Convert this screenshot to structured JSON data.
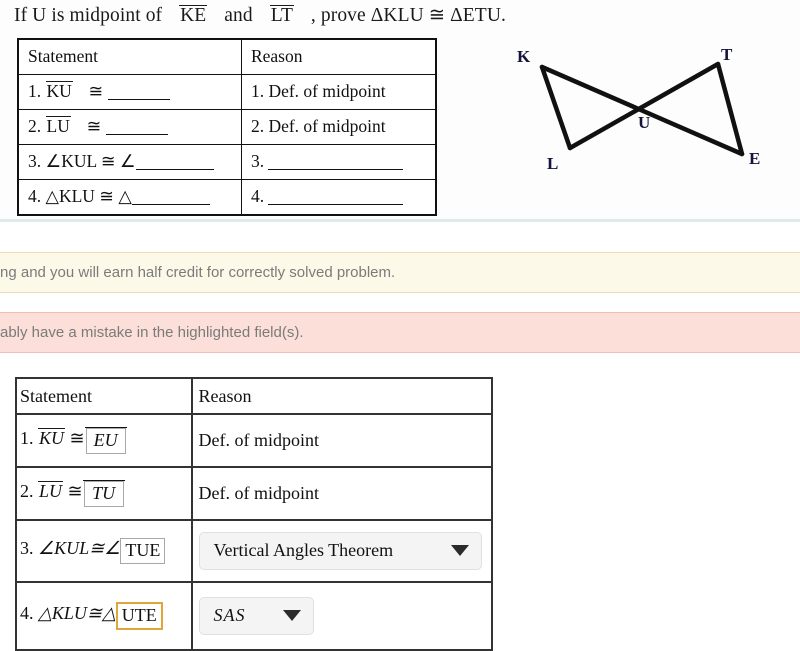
{
  "problem": {
    "prefix": "If U is midpoint of",
    "seg1": "KE",
    "conjunction": "and",
    "seg2": "LT",
    "suffix": ", prove ΔKLU ≅ ΔETU."
  },
  "proof_table_image": {
    "headers": [
      "Statement",
      "Reason"
    ],
    "rows": [
      {
        "statement_num": "1.",
        "statement_seg": "KU",
        "statement_rel": "≅",
        "reason": "1. Def. of midpoint"
      },
      {
        "statement_num": "2.",
        "statement_seg": "LU",
        "statement_rel": "≅",
        "reason": "2. Def. of midpoint"
      },
      {
        "statement_num": "3.",
        "statement_text": "∠KUL ≅ ∠",
        "reason": "3."
      },
      {
        "statement_num": "4.",
        "statement_text": "△KLU ≅ △",
        "reason": "4."
      }
    ]
  },
  "figure": {
    "labels": {
      "K": "K",
      "T": "T",
      "L": "L",
      "E": "E",
      "U": "U"
    }
  },
  "banners": {
    "info": {
      "text": "ng and you will earn half credit for correctly solved problem.",
      "bg": "#fdf9e8",
      "border": "#ecdfb4"
    },
    "error": {
      "text": "ably have a mistake in the highlighted field(s).",
      "bg": "#fbdfd8",
      "border": "#f0bfb2"
    }
  },
  "answer_table": {
    "headers": {
      "statement": "Statement",
      "reason": "Reason"
    },
    "rows": [
      {
        "num": "1.",
        "left_seg": "KU",
        "rel": "≅",
        "input_value": "EU",
        "input_overline": true,
        "input_italic": true,
        "input_flagged": false,
        "reason_type": "text",
        "reason_text": "Def. of midpoint"
      },
      {
        "num": "2.",
        "left_seg": "LU",
        "rel": "≅",
        "input_value": "TU",
        "input_overline": true,
        "input_italic": true,
        "input_flagged": false,
        "reason_type": "text",
        "reason_text": "Def. of midpoint"
      },
      {
        "num": "3.",
        "left_text": "∠KUL≅∠",
        "input_value": "TUE",
        "input_overline": false,
        "input_italic": false,
        "input_flagged": false,
        "reason_type": "select",
        "reason_text": "Vertical Angles Theorem"
      },
      {
        "num": "4.",
        "left_text": "△KLU≅△",
        "input_value": "UTE",
        "input_overline": false,
        "input_italic": false,
        "input_flagged": true,
        "reason_type": "select",
        "reason_text": "SAS"
      }
    ]
  },
  "colors": {
    "flag_border": "#e0a63c",
    "divider": "#dfeaea",
    "dropdown_bg": "#f4f4f4"
  }
}
